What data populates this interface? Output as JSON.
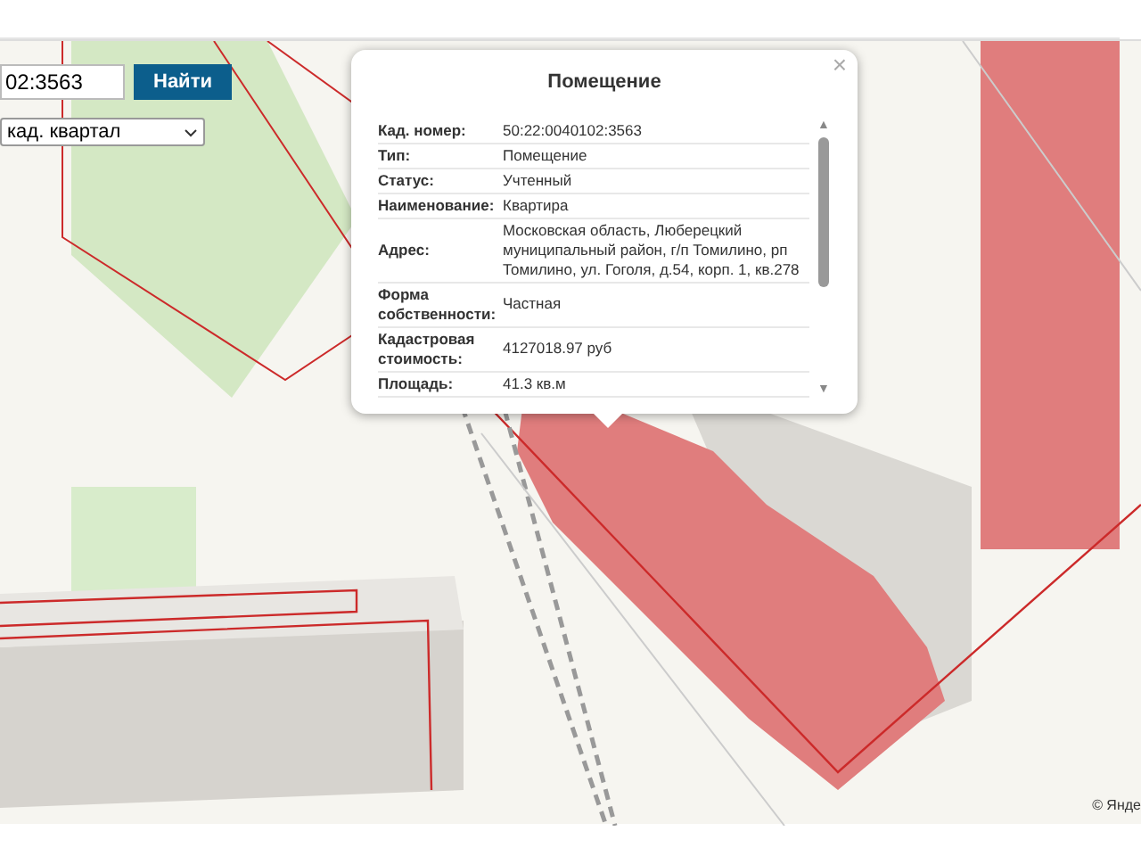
{
  "search": {
    "value": "02:3563",
    "button": "Найти"
  },
  "layer_select": {
    "value": "кад. квартал"
  },
  "popup": {
    "title": "Помещение",
    "close": "×",
    "scroll_up": "▲",
    "scroll_down": "▼",
    "rows": [
      {
        "label": "Кад. номер:",
        "value": "50:22:0040102:3563"
      },
      {
        "label": "Тип:",
        "value": "Помещение"
      },
      {
        "label": "Статус:",
        "value": "Учтенный"
      },
      {
        "label": "Наименование:",
        "value": "Квартира"
      },
      {
        "label": "Адрес:",
        "value": "Московская область, Люберецкий муниципальный район, г/п Томилино, рп Томилино, ул. Гоголя, д.54, корп. 1, кв.278"
      },
      {
        "label": "Форма собственности:",
        "value": "Частная"
      },
      {
        "label": "Кадастровая стоимость:",
        "value": "4127018.97 руб"
      },
      {
        "label": "Площадь:",
        "value": "41.3 кв.м"
      }
    ]
  },
  "map": {
    "attribution": "© Янде"
  }
}
